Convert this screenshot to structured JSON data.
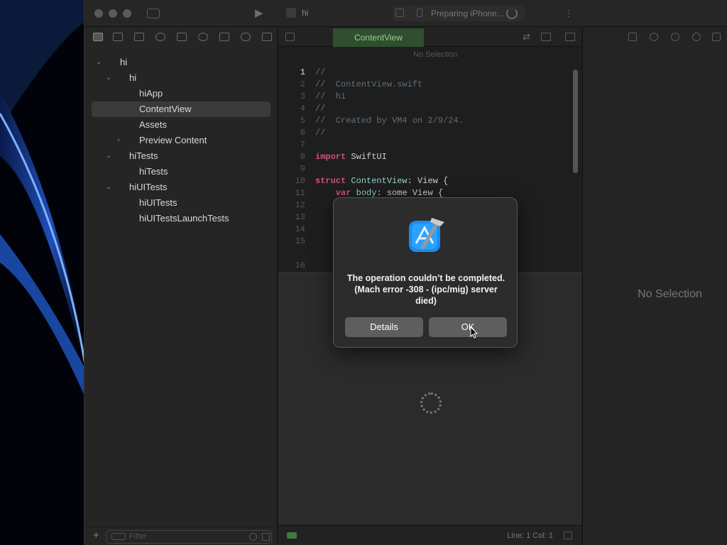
{
  "toolbar": {
    "project_name": "hi",
    "status_text": "Preparing iPhone..."
  },
  "navigator": {
    "items": [
      {
        "label": "hi",
        "level": 0,
        "expanded": true
      },
      {
        "label": "hi",
        "level": 1,
        "expanded": true
      },
      {
        "label": "hiApp",
        "level": 2
      },
      {
        "label": "ContentView",
        "level": 2,
        "selected": true
      },
      {
        "label": "Assets",
        "level": 2
      },
      {
        "label": "Preview Content",
        "level": 2,
        "expanded": false
      },
      {
        "label": "hiTests",
        "level": 1,
        "expanded": true
      },
      {
        "label": "hiTests",
        "level": 2
      },
      {
        "label": "hiUITests",
        "level": 1,
        "expanded": true
      },
      {
        "label": "hiUITests",
        "level": 2
      },
      {
        "label": "hiUITestsLaunchTests",
        "level": 2
      }
    ],
    "filter_placeholder": "Filter"
  },
  "editor": {
    "tab_label": "ContentView",
    "jump_bar": "No Selection",
    "code_lines": [
      {
        "n": "1",
        "text": "//"
      },
      {
        "n": "2",
        "text": "//  ContentView.swift"
      },
      {
        "n": "3",
        "text": "//  hi"
      },
      {
        "n": "4",
        "text": "//"
      },
      {
        "n": "5",
        "text": "//  Created by VM4 on 2/9/24."
      },
      {
        "n": "6",
        "text": "//"
      },
      {
        "n": "7",
        "text": ""
      },
      {
        "n": "8",
        "kw": "import",
        "rest": " SwiftUI"
      },
      {
        "n": "9",
        "text": ""
      },
      {
        "n": "10",
        "kw": "struct",
        "ty": " ContentView",
        "rest": ": View {"
      },
      {
        "n": "11",
        "kw": "    var",
        "ty": " body",
        "rest": ": some View {"
      },
      {
        "n": "12",
        "text": ""
      },
      {
        "n": "13",
        "text": ""
      },
      {
        "n": "14",
        "text": ""
      },
      {
        "n": "15",
        "text": ""
      },
      {
        "n": "16",
        "text": ""
      }
    ],
    "status_position": "Line: 1  Col: 1"
  },
  "inspector": {
    "empty_text": "No Selection"
  },
  "alert": {
    "message": "The operation couldn’t be completed. (Mach error -308 - (ipc/mig) server died)",
    "details_label": "Details",
    "ok_label": "OK"
  },
  "colors": {
    "accent_tab": "#2f4f2f",
    "alert_bg": "#2c2c2c",
    "button_bg": "#5e5e5e"
  }
}
